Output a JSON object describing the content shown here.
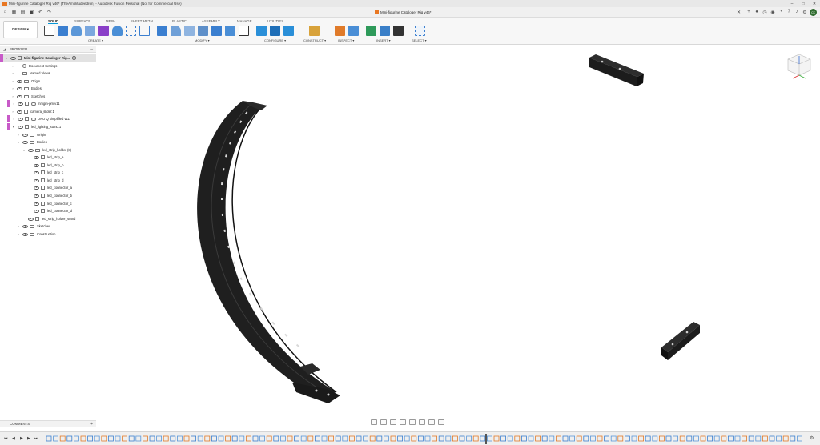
{
  "titlebar": {
    "title": "Mini-figurine Cataloger Rig v46* (TheAmplitudeedron) - Autodesk Fusion Personal (Not for Commercial Use)",
    "minimize": "–",
    "maximize": "□",
    "close": "✕"
  },
  "tabbar": {
    "doc_tab": "Mini-figurine Cataloger Rig v46*",
    "close": "✕",
    "avatar": "CK",
    "plus": "+"
  },
  "toolbar": {
    "design_label": "DESIGN ▾",
    "tabs": [
      "SOLID",
      "SURFACE",
      "MESH",
      "SHEET METAL",
      "PLASTIC",
      "ASSEMBLY",
      "MANAGE",
      "UTILITIES"
    ],
    "groups": [
      "CREATE ▾",
      "MODIFY ▾",
      "CONFIGURE ▾",
      "CONSTRUCT ▾",
      "INSPECT ▾",
      "INSERT ▾",
      "SELECT ▾"
    ]
  },
  "browser": {
    "title": "BROWSER",
    "items": [
      {
        "label": "Mini-figurine Cataloger Rig..."
      },
      {
        "label": "Document Settings"
      },
      {
        "label": "Named Views"
      },
      {
        "label": "Origin"
      },
      {
        "label": "Bodies"
      },
      {
        "label": "Sketches"
      },
      {
        "label": "mmgm-pm v11"
      },
      {
        "label": "camera_slider:1"
      },
      {
        "label": "UNO Q simplified v11"
      },
      {
        "label": "led_lighting_stand:1"
      },
      {
        "label": "Origin"
      },
      {
        "label": "Bodies"
      },
      {
        "label": "led_strip_holder (8)"
      },
      {
        "label": "led_strip_a"
      },
      {
        "label": "led_strip_b"
      },
      {
        "label": "led_strip_c"
      },
      {
        "label": "led_strip_d"
      },
      {
        "label": "led_connector_a"
      },
      {
        "label": "led_connector_b"
      },
      {
        "label": "led_connector_c"
      },
      {
        "label": "led_connector_d"
      },
      {
        "label": "led_strip_holder_stand"
      },
      {
        "label": "Sketches"
      },
      {
        "label": "Construction"
      }
    ]
  },
  "comments": {
    "title": "COMMENTS",
    "plus": "+"
  },
  "timeline": {
    "first": "⏮",
    "prev": "◀",
    "play": "▶",
    "next": "▶",
    "last": "⏭",
    "settings": "⚙"
  },
  "colors": {
    "accent": "#0696d7",
    "brand": "#e87722",
    "model": "#1f1f1f"
  }
}
